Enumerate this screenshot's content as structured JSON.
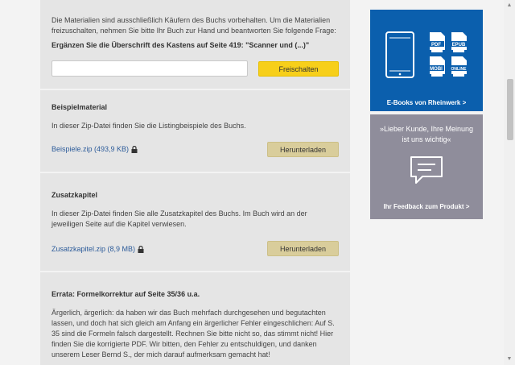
{
  "unlock": {
    "intro": "Die Materialien sind ausschließlich Käufern des Buchs vorbehalten. Um die Materialien freizuschalten, nehmen Sie bitte Ihr Buch zur Hand und beantworten Sie folgende Frage:",
    "question": "Ergänzen Sie die Überschrift des Kastens auf Seite 419: \"Scanner und (...)\"",
    "input_value": "",
    "button_label": "Freischalten"
  },
  "materials": [
    {
      "title": "Beispielmaterial",
      "description": "In dieser Zip-Datei finden Sie die Listingbeispiele des Buchs.",
      "file_label": "Beispiele.zip (493,9 KB)",
      "button_label": "Herunterladen"
    },
    {
      "title": "Zusatzkapitel",
      "description": "In dieser Zip-Datei finden Sie alle Zusatzkapitel des Buchs. Im Buch wird an der jeweiligen Seite auf die Kapitel verwiesen.",
      "file_label": "Zusatzkapitel.zip (8,9 MB)",
      "button_label": "Herunterladen"
    }
  ],
  "errata": {
    "title": "Errata: Formelkorrektur auf Seite 35/36 u.a.",
    "text": "Ärgerlich, ärgerlich: da haben wir das Buch mehrfach durchgesehen und begutachten lassen, und doch hat sich gleich am Anfang ein ärgerlicher Fehler eingeschlichen: Auf S. 35 sind die Formeln falsch dargestellt. Rechnen Sie bitte nicht so, das stimmt nicht! Hier finden Sie die korrigierte PDF. Wir bitten, den Fehler zu entschuldigen, und danken unserem Leser Bernd S., der mich darauf aufmerksam gemacht hat!"
  },
  "sidebar": {
    "ebooks": {
      "formats": [
        "PDF",
        "EPUB",
        "MOBI",
        "ONLINE"
      ],
      "caption": "E-Books von Rheinwerk  >"
    },
    "feedback": {
      "text": "»Lieber Kunde, Ihre Meinung ist uns wichtig«",
      "caption": "Ihr Feedback zum Produkt  >"
    }
  },
  "colors": {
    "accent_yellow": "#f7cf1a",
    "ebook_blue": "#0b5fad",
    "feedback_gray": "#8f8d9b",
    "download_button": "#d9cd9b",
    "link_blue": "#2d5c9a"
  }
}
